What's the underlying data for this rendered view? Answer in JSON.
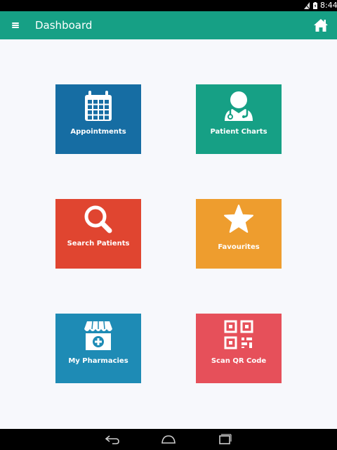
{
  "status_bar": {
    "time": "8:44",
    "icons": [
      "signal-icon",
      "battery-icon"
    ]
  },
  "app_bar": {
    "title": "Dashboard",
    "menu_icon": "menu-icon",
    "home_icon": "home-icon"
  },
  "tiles": [
    {
      "label": "Appointments",
      "icon": "calendar-icon",
      "color": "#166da3"
    },
    {
      "label": "Patient Charts",
      "icon": "doctor-icon",
      "color": "#16a085"
    },
    {
      "label": "Search Patients",
      "icon": "search-icon",
      "color": "#e04530"
    },
    {
      "label": "Favourites",
      "icon": "star-icon",
      "color": "#ee9d2e"
    },
    {
      "label": "My Pharmacies",
      "icon": "store-icon",
      "color": "#1e8bb5"
    },
    {
      "label": "Scan QR Code",
      "icon": "qr-code-icon",
      "color": "#e6505a"
    }
  ],
  "colors": {
    "app_bar": "#16a085",
    "background": "#f7f8fc"
  },
  "nav_bar": {
    "icons": [
      "back-icon",
      "home-nav-icon",
      "recents-icon"
    ]
  }
}
